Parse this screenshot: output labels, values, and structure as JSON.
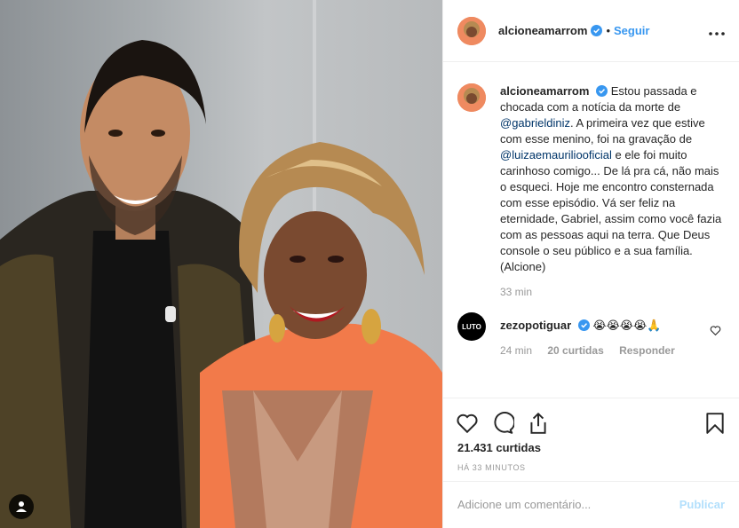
{
  "photo": {
    "alt": ""
  },
  "header": {
    "username": "alcioneamarrom",
    "separator": "•",
    "follow_label": "Seguir",
    "more_label": "•••"
  },
  "caption": {
    "username": "alcioneamarrom",
    "part1": "Estou passada e chocada com a notícia da morte de",
    "mention1": "@gabrieldiniz",
    "part2": ". A primeira vez que estive com esse menino, foi na gravação de",
    "mention2": "@luizaemauriliooficial",
    "part3": "e ele foi muito carinhoso comigo... De lá pra cá, não mais o esqueci. Hoje me encontro consternada com esse episódio. Vá ser feliz na eternidade, Gabriel, assim como você fazia com as pessoas aqui na terra. Que Deus console o seu público e a sua família. (Alcione)",
    "time": "33 min"
  },
  "comment": {
    "avatar_text": "LUTO",
    "username": "zezopotiguar",
    "emojis": "😭😭😭😭🙏",
    "time": "24 min",
    "likes": "20 curtidas",
    "reply": "Responder"
  },
  "actions": {
    "likes": "21.431 curtidas",
    "ago": "HÁ 33 MINUTOS"
  },
  "add_comment": {
    "placeholder": "Adicione um comentário...",
    "publish_label": "Publicar"
  },
  "colors": {
    "link": "#3897f0",
    "mention": "#003569",
    "muted": "#999999",
    "publish_disabled": "#b2dffc"
  }
}
